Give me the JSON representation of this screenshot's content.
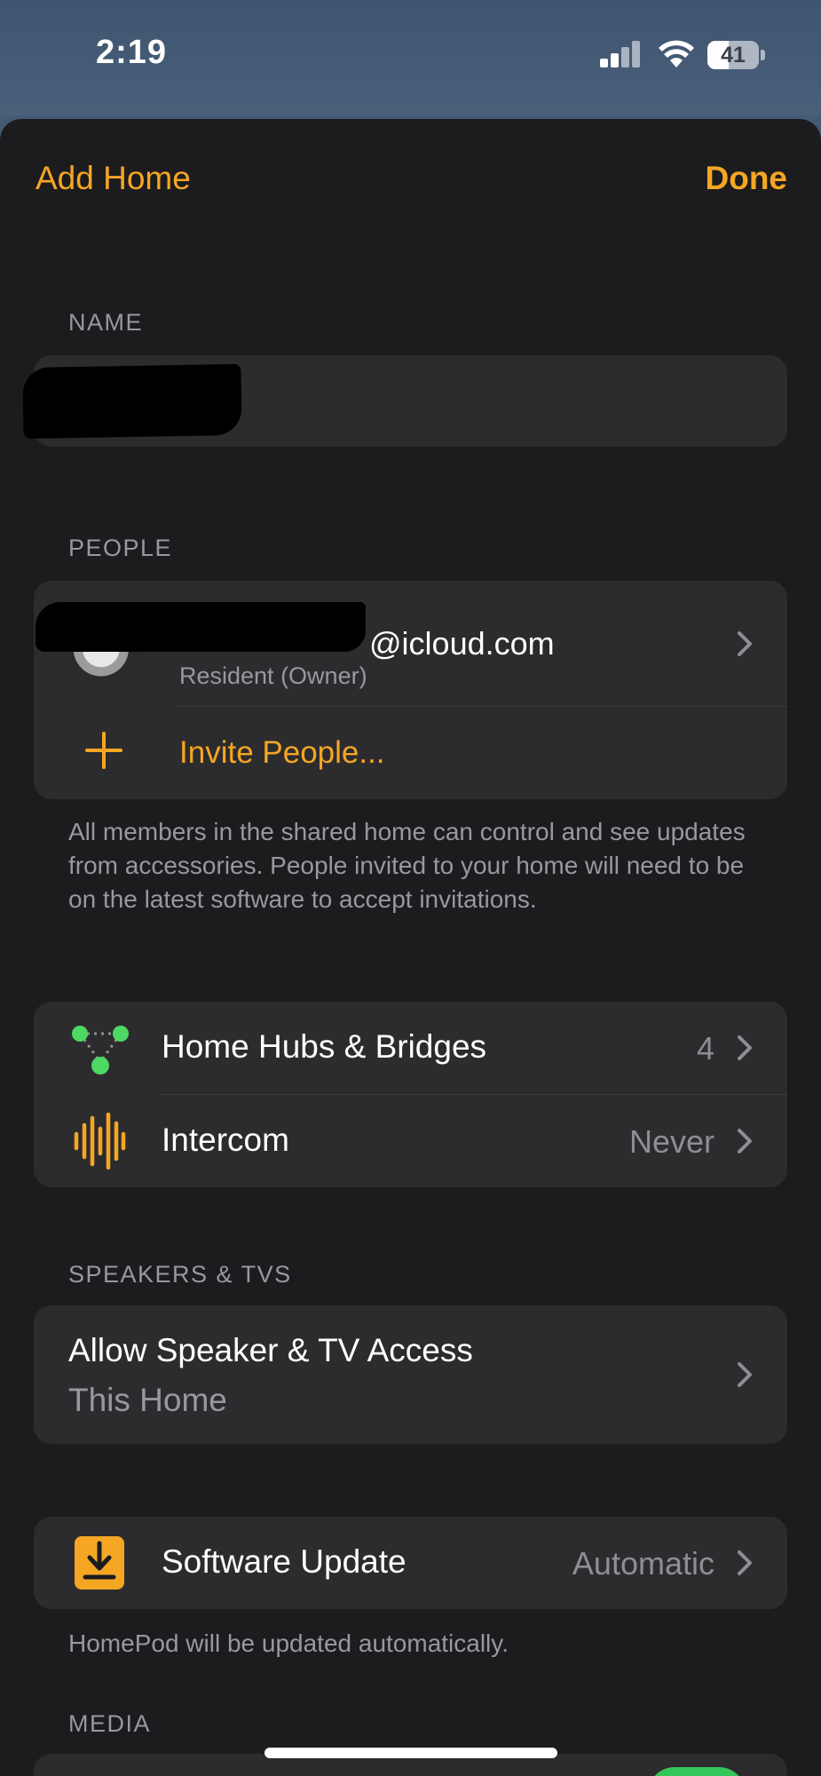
{
  "status_bar": {
    "time": "2:19",
    "battery_level": "41",
    "battery_fraction": 0.41,
    "signal_bars": 2,
    "signal_icon": "cellular-signal-icon",
    "wifi_icon": "wifi-icon"
  },
  "nav": {
    "left_label": "Add Home",
    "right_label": "Done"
  },
  "name_section": {
    "header": "NAME",
    "value": ""
  },
  "people_section": {
    "header": "PEOPLE",
    "member_email": "@icloud.com",
    "member_role": "Resident (Owner)",
    "invite_label": "Invite People...",
    "footer": "All members in the shared home can control and see updates from accessories. People invited to your home will need to be on the latest software to accept invitations."
  },
  "hubs_section": {
    "hubs_label": "Home Hubs & Bridges",
    "hubs_count": "4",
    "intercom_label": "Intercom",
    "intercom_value": "Never"
  },
  "speakers_section": {
    "header": "SPEAKERS & TVS",
    "title": "Allow Speaker & TV Access",
    "subtitle": "This Home"
  },
  "update_section": {
    "label": "Software Update",
    "value": "Automatic",
    "footer": "HomePod will be updated automatically."
  },
  "media_section": {
    "header": "MEDIA"
  },
  "colors": {
    "accent": "#f5a623",
    "background": "#1c1c1e",
    "card": "#2c2c2e",
    "secondary_text": "#98989f",
    "hub_green": "#4cd964",
    "toggle_on": "#34c759"
  }
}
